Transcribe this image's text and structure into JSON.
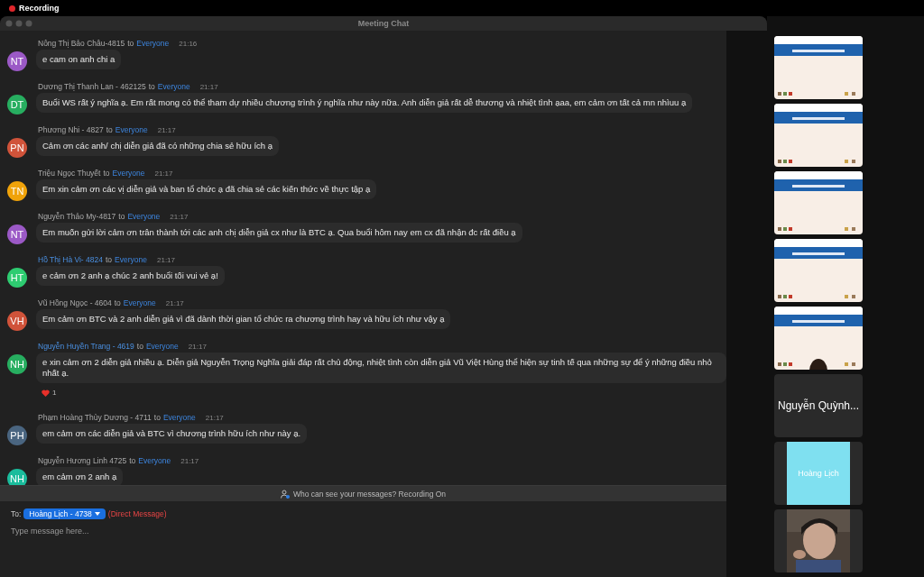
{
  "recording": {
    "label": "Recording",
    "on": true
  },
  "window": {
    "title": "Meeting Chat"
  },
  "messages": [
    {
      "initials": "NT",
      "color": "#9b59c6",
      "sender": "Nông Thị Bảo Châu-4815",
      "name_highlighted": false,
      "to_word": "to",
      "recipient": "Everyone",
      "time": "21:16",
      "text": "e cam on anh chi a"
    },
    {
      "initials": "DT",
      "color": "#27ae60",
      "sender": "Dương Thị Thanh Lan - 462125",
      "name_highlighted": false,
      "to_word": "to",
      "recipient": "Everyone",
      "time": "21:17",
      "text": "Buổi WS rất ý nghĩa ạ. Em rất mong có thể tham dự nhiều chương trình ý nghĩa như này nữa. Anh diễn giả rất dễ thương và nhiệt tình ạaa, em cảm ơn tất cả mn nhìuu ạ"
    },
    {
      "initials": "PN",
      "color": "#d0533a",
      "sender": "Phương Nhi - 4827",
      "name_highlighted": false,
      "to_word": "to",
      "recipient": "Everyone",
      "time": "21:17",
      "text": "Cảm ơn các anh/ chị diễn giả đã có những chia sẻ hữu ích ạ"
    },
    {
      "initials": "TN",
      "color": "#f0a30a",
      "sender": "Triệu Ngọc Thuyết",
      "name_highlighted": false,
      "to_word": "to",
      "recipient": "Everyone",
      "time": "21:17",
      "text": "Em xin cảm ơn các vị diễn giả và ban tổ chức ạ đã chia sẻ các kiến thức về thực tập ạ"
    },
    {
      "initials": "NT",
      "color": "#9b59c6",
      "sender": "Nguyễn Thảo My-4817",
      "name_highlighted": false,
      "to_word": "to",
      "recipient": "Everyone",
      "time": "21:17",
      "text": "Em muốn gửi lời cảm ơn trân thành tới các anh chị diễn giả cx như là BTC ạ. Qua buổi hôm nay em cx đã nhận đc rất điều ạ"
    },
    {
      "initials": "HT",
      "color": "#2ecc71",
      "sender": "Hồ Thị Hà Vi- 4824",
      "name_highlighted": true,
      "to_word": "to",
      "recipient": "Everyone",
      "time": "21:17",
      "text": "e cảm ơn 2 anh ạ chúc 2 anh buổi tối vui vẻ ạ!"
    },
    {
      "initials": "VH",
      "color": "#d0533a",
      "sender": "Vũ Hồng Ngọc - 4604",
      "name_highlighted": false,
      "to_word": "to",
      "recipient": "Everyone",
      "time": "21:17",
      "text": "Em cảm ơn BTC và 2 anh diễn giả vì đã dành thời gian tổ chức ra chương trình hay và hữu ích như vậy ạ"
    },
    {
      "initials": "NH",
      "color": "#27ae60",
      "sender": "Nguyễn Huyền Trang - 4619",
      "name_highlighted": true,
      "to_word": "to",
      "recipient": "Everyone",
      "time": "21:17",
      "text": "e xin cảm ơn 2 diễn giả nhiều ạ. Diễn giả Nguyễn Trọng Nghĩa giải đáp rất chủ động, nhiệt tình còn diễn giả Vũ Việt Hùng thể hiện sự tinh tế qua những sự để ý những điều nhỏ nhất ạ.",
      "reactions": [
        {
          "count": "1"
        }
      ]
    },
    {
      "initials": "PH",
      "color": "#4a6580",
      "sender": "Phạm Hoàng Thùy Dương - 4711",
      "name_highlighted": false,
      "to_word": "to",
      "recipient": "Everyone",
      "time": "21:17",
      "text": "em cảm ơn các diễn giả và BTC vì chương trình hữu ích như này ạ."
    },
    {
      "initials": "NH",
      "color": "#1abc9c",
      "sender": "Nguyễn Hương Linh 4725",
      "name_highlighted": false,
      "to_word": "to",
      "recipient": "Everyone",
      "time": "21:17",
      "text": "em cảm ơn 2 anh ạ"
    }
  ],
  "notice": "Who can see your messages? Recording On",
  "composer": {
    "to_label": "To:",
    "recipient": "Hoàng Lịch - 4738",
    "mode": "(Direct Message)",
    "placeholder": "Type message here..."
  },
  "participants": [
    {
      "kind": "slide"
    },
    {
      "kind": "slide"
    },
    {
      "kind": "slide"
    },
    {
      "kind": "slide"
    },
    {
      "kind": "slide_person"
    },
    {
      "kind": "name",
      "name": "Nguyễn Quỳnh..."
    },
    {
      "kind": "avatar",
      "name": "Hoàng Lịch"
    },
    {
      "kind": "picture"
    }
  ]
}
